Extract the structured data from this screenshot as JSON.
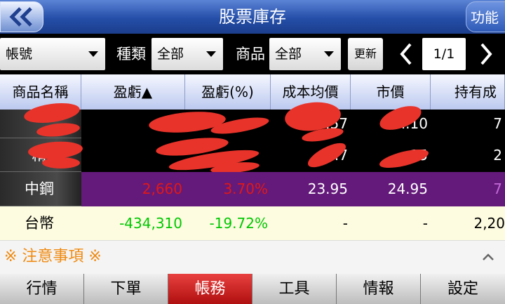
{
  "header": {
    "title": "股票庫存",
    "function_label": "功能"
  },
  "filters": {
    "account_value": "帳號",
    "type_label": "種類",
    "type_value": "全部",
    "product_label": "商品",
    "product_value": "全部",
    "refresh_label": "更新",
    "page_indicator": "1/1"
  },
  "table": {
    "headers": [
      "商品名稱",
      "盈虧▲",
      "盈虧(%)",
      "成本均價",
      "市價",
      "持有成"
    ],
    "rows": [
      {
        "name": "",
        "pl": "",
        "pl_pct": "",
        "cost": "...57",
        "price": "...10",
        "hold": "7"
      },
      {
        "name": "精",
        "pl": "",
        "pl_pct": "",
        "cost": "...7",
        "price": "...15",
        "hold": "2"
      },
      {
        "name": "中鋼",
        "pl": "2,660",
        "pl_pct": "3.70%",
        "cost": "23.95",
        "price": "24.95",
        "hold": "7"
      },
      {
        "name": "台幣",
        "pl": "-434,310",
        "pl_pct": "-19.72%",
        "cost": "-",
        "price": "-",
        "hold": "2,20"
      }
    ]
  },
  "notice": {
    "text": "※ 注意事項 ※"
  },
  "tabs": [
    "行情",
    "下單",
    "帳務",
    "工具",
    "情報",
    "設定"
  ],
  "colors": {
    "accent": "#2f5bb8",
    "active_tab": "#c81e1e",
    "row_purple": "#641a7a",
    "row_cream": "#fdfce0",
    "profit": "#e01818",
    "loss": "#00c800",
    "notice": "#f08a10"
  }
}
